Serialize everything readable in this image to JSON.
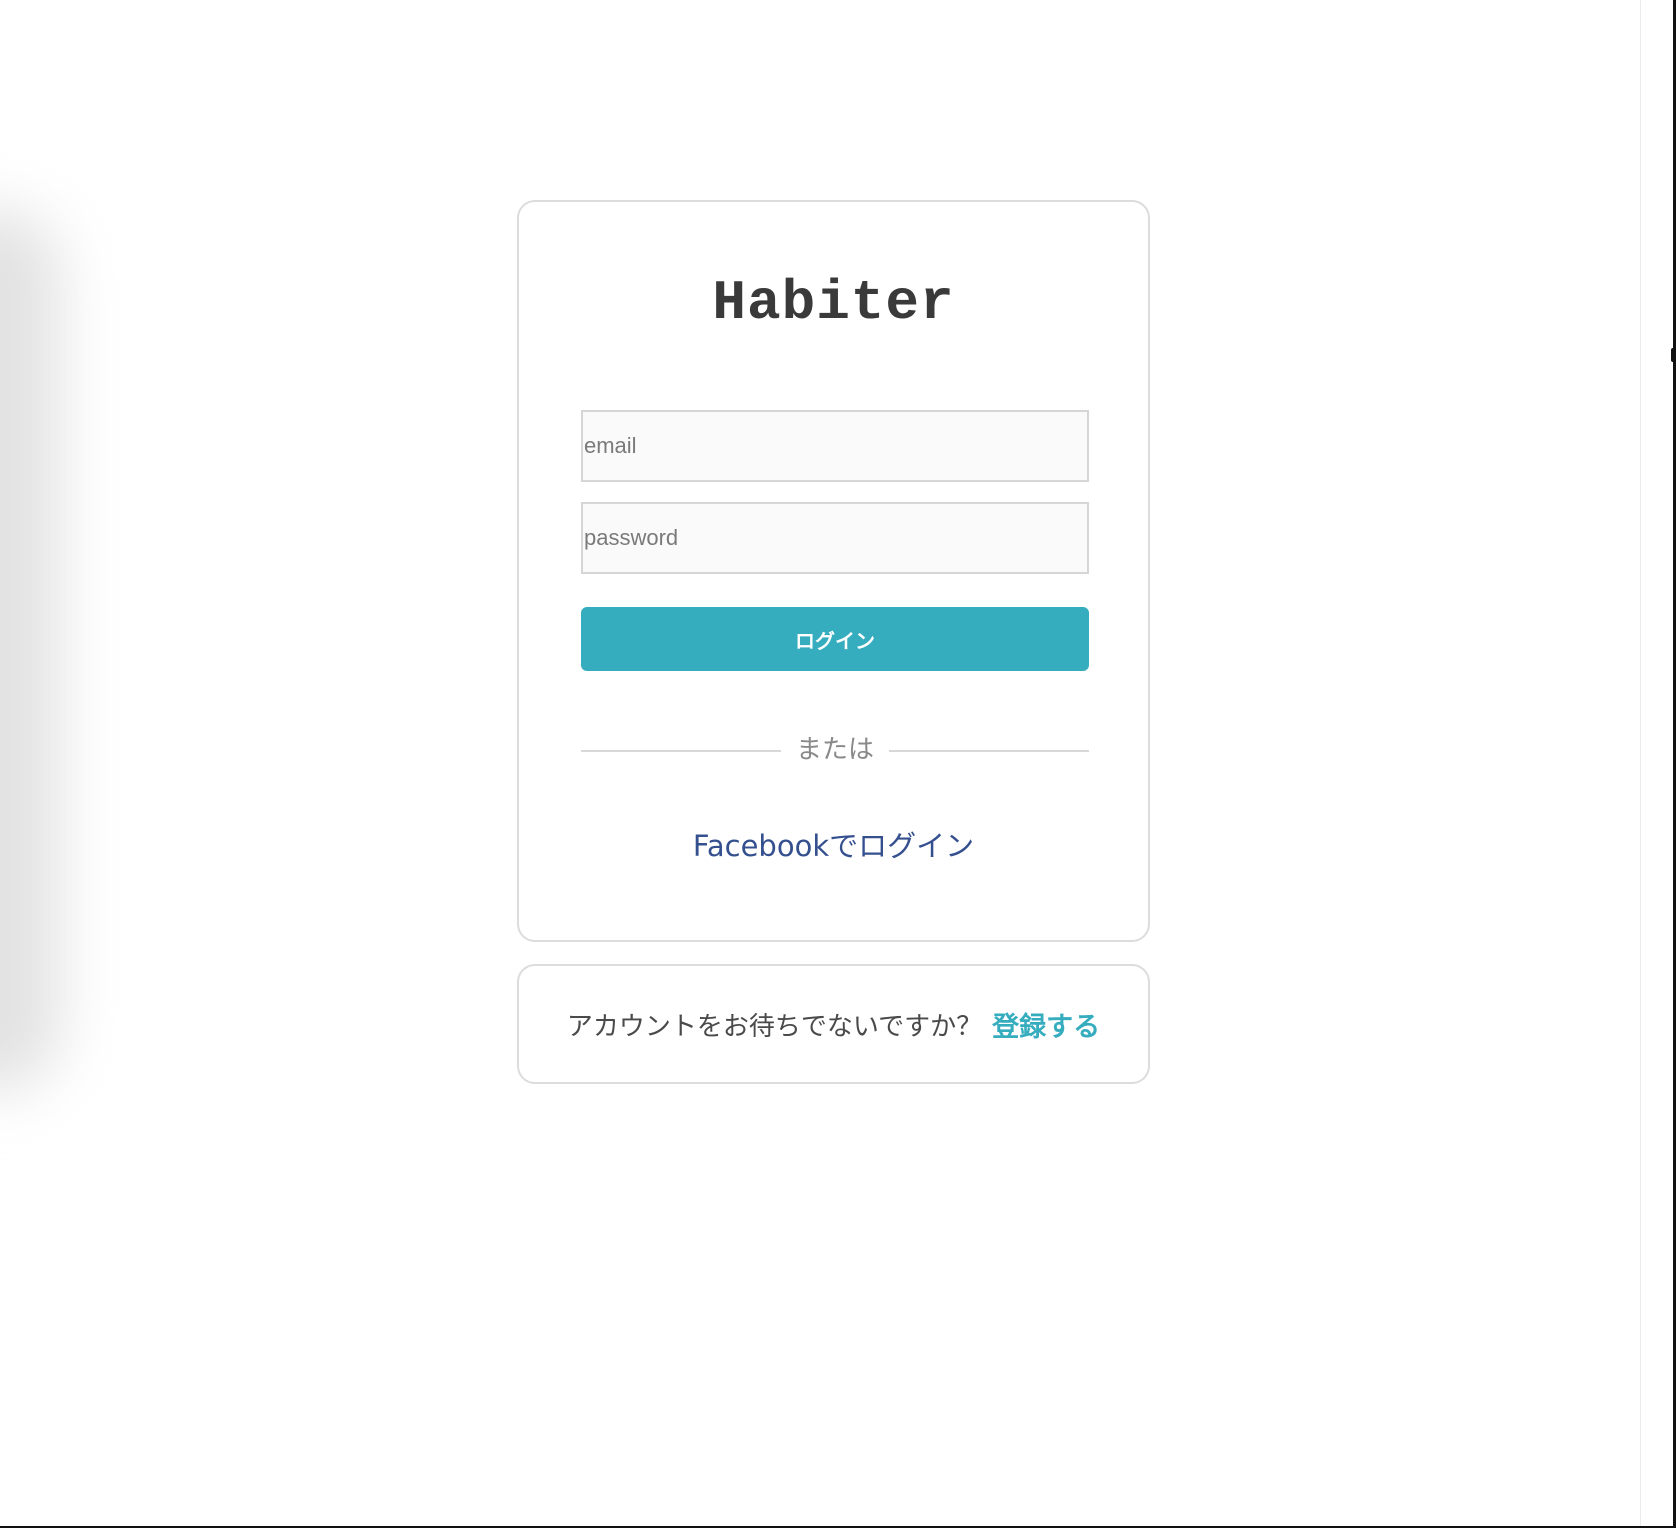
{
  "app": {
    "title": "Habiter"
  },
  "login_form": {
    "email": {
      "value": "",
      "placeholder": "email"
    },
    "password": {
      "value": "",
      "placeholder": "password"
    },
    "submit_label": "ログイン",
    "divider_label": "または",
    "facebook_login_label": "Facebookでログイン"
  },
  "signup": {
    "prompt": "アカウントをお待ちでないですか？",
    "link_label": "登録する"
  },
  "colors": {
    "accent": "#35adbe",
    "facebook": "#35508f",
    "title_text": "#3a3a3a",
    "border": "#dcdcdc",
    "input_background": "#fafafa"
  }
}
